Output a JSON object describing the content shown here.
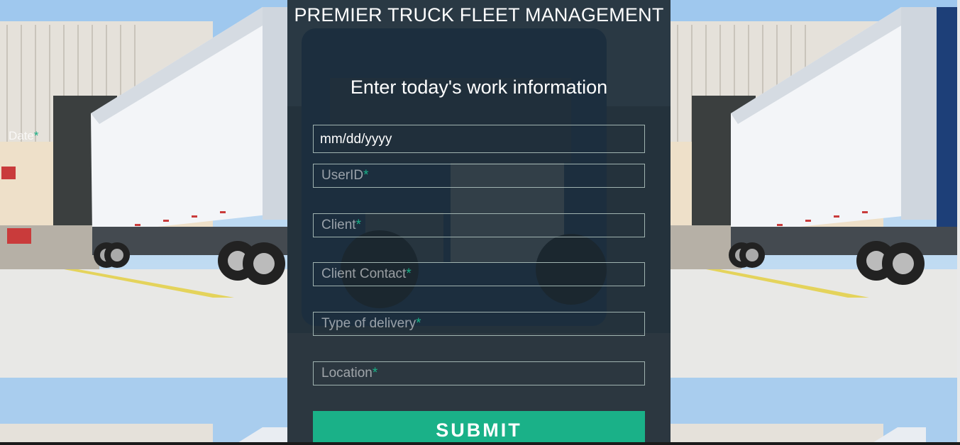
{
  "header": {
    "title": "PREMIER TRUCK FLEET MANAGEMENT",
    "subtitle": "Enter today's work information"
  },
  "background": {
    "ghost_label": "Date",
    "ghost_required": "*"
  },
  "form": {
    "date_value": "mm/dd/yyyy",
    "required_mark": "*",
    "fields": [
      {
        "label": "UserID"
      },
      {
        "label": "Client"
      },
      {
        "label": "Client Contact"
      },
      {
        "label": "Type of delivery"
      },
      {
        "label": "Location"
      }
    ],
    "submit_label": "SUBMIT"
  },
  "colors": {
    "accent": "#1ab188",
    "panel": "#24323c",
    "field_border": "#a0b3b0"
  },
  "icons": [
    "truck-photo-background"
  ]
}
